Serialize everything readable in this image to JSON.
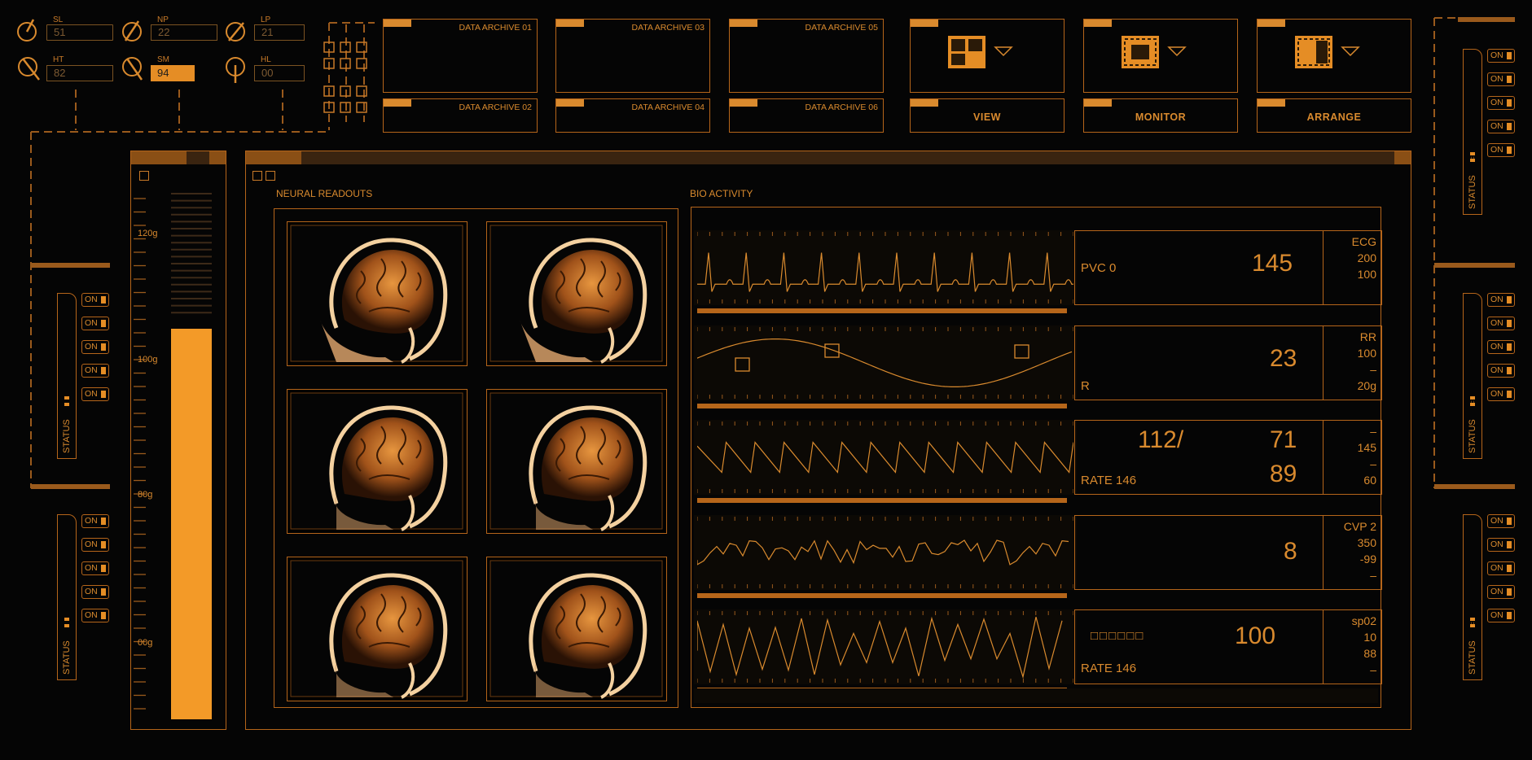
{
  "knobs": [
    {
      "label": "SL",
      "value": "51"
    },
    {
      "label": "NP",
      "value": "22"
    },
    {
      "label": "LP",
      "value": "21"
    },
    {
      "label": "HT",
      "value": "82"
    },
    {
      "label": "SM",
      "value": "94"
    },
    {
      "label": "HL",
      "value": "00"
    }
  ],
  "archives": [
    "DATA ARCHIVE 01",
    "DATA ARCHIVE 02",
    "DATA ARCHIVE 03",
    "DATA ARCHIVE 04",
    "DATA ARCHIVE 05",
    "DATA ARCHIVE 06"
  ],
  "mode_buttons": [
    {
      "label": "VIEW",
      "icon": "layout-grid-icon"
    },
    {
      "label": "MONITOR",
      "icon": "monitor-icon"
    },
    {
      "label": "ARRANGE",
      "icon": "arrange-icon"
    }
  ],
  "switch_label": "ON",
  "status_label": "STATUS",
  "gauge": {
    "ticks": [
      "120g",
      "100g",
      "80g",
      "00g"
    ],
    "fill_fraction": 0.74
  },
  "panels": {
    "neural": "NEURAL READOUTS",
    "bio": "BIO ACTIVITY"
  },
  "vitals": [
    {
      "left_label": "PVC 0",
      "value": "145",
      "scale": [
        "ECG",
        "200",
        "100"
      ]
    },
    {
      "left_label": "R",
      "value": "23",
      "scale": [
        "RR",
        "100",
        "–",
        "20g"
      ]
    },
    {
      "left_label": "RATE 146",
      "value_a": "112/",
      "value_b": "71",
      "value_c": "89",
      "scale": [
        "–",
        "145",
        "–",
        "60"
      ]
    },
    {
      "left_label": "",
      "value": "8",
      "scale": [
        "CVP 2",
        "350",
        "-99",
        "–"
      ]
    },
    {
      "left_label": "RATE 146",
      "value": "100",
      "boxes": "□□□□□□",
      "scale": [
        "sp02",
        "10",
        "88",
        "–"
      ]
    }
  ],
  "colors": {
    "accent": "#f39a28",
    "line": "#b5651a",
    "background": "#050505"
  }
}
